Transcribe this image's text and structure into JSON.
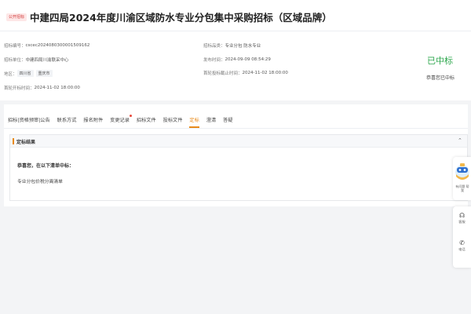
{
  "header": {
    "badge": "公开招标",
    "title": "中建四局2024年度川渝区域防水专业分包集中采购招标（区域品牌）"
  },
  "info": {
    "code_label": "招标编号：",
    "code_value": "cscec2024080300001509162",
    "unit_label": "招标单位：",
    "unit_value": "中建四局川渝联采中心",
    "region_label": "地区：",
    "region_tags": [
      "四川省",
      "重庆市"
    ],
    "open_label": "首轮开标时间：",
    "open_value": "2024-11-02 18:00:00",
    "category_label": "招标品类：",
    "category_value": "专业分包 防水专业",
    "publish_label": "发布时间：",
    "publish_value": "2024-09-09 08:54:29",
    "deadline_label": "首轮投标截止时间：",
    "deadline_value": "2024-11-02 18:00:00"
  },
  "status": {
    "main": "已中标",
    "sub": "恭喜您已中标",
    "color": "#2fa84f"
  },
  "tabs": [
    {
      "label": "招标|资格预审|公告"
    },
    {
      "label": "联系方式"
    },
    {
      "label": "报名附件"
    },
    {
      "label": "变更记录"
    },
    {
      "label": "招标文件"
    },
    {
      "label": "投标文件"
    },
    {
      "label": "定标"
    },
    {
      "label": "澄清"
    },
    {
      "label": "答疑"
    }
  ],
  "active_tab_color": "#e88a1a",
  "panel": {
    "title": "定标结果",
    "congrats": "恭喜您，在以下清单中标：",
    "package": "专业分包价税分离清单"
  },
  "float": {
    "helper_label": "有问题 帮我",
    "service_label": "客服",
    "phone_label": "电话",
    "service_icon": "headset-icon",
    "phone_icon": "phone-icon"
  }
}
